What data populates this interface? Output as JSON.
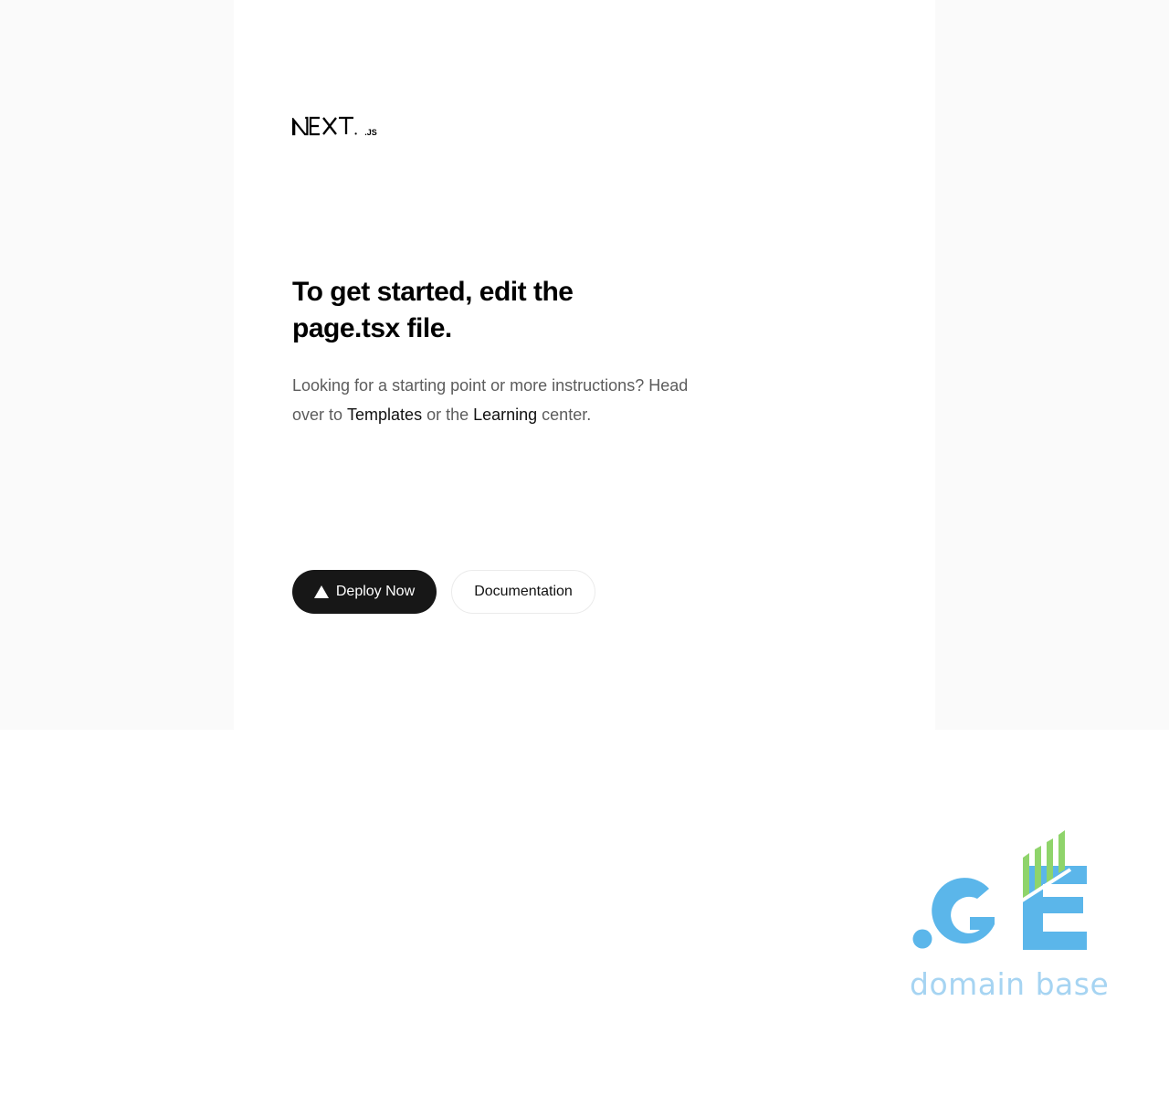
{
  "header": {
    "logo_wordmark": "NEXT",
    "logo_suffix": ".JS"
  },
  "main": {
    "headline": "To get started, edit the page.tsx file.",
    "intro_prefix": "Looking for a starting point or more instructions? Head over to ",
    "templates_link": "Templates",
    "intro_middle": " or the ",
    "learning_link": "Learning",
    "intro_suffix": " center."
  },
  "actions": {
    "deploy_label": "Deploy Now",
    "docs_label": "Documentation"
  },
  "watermark": {
    "logo_text": ".GE",
    "caption": "domain base"
  },
  "colors": {
    "page_bg": "#fafafa",
    "card_bg": "#ffffff",
    "primary_button": "#171717",
    "text_muted": "#5c5c5c",
    "ge_blue": "#5bb6ea",
    "ge_green": "#8fd46b",
    "ge_caption": "#a6d4f2"
  },
  "icons": {
    "deploy": "vercel-triangle-icon"
  }
}
